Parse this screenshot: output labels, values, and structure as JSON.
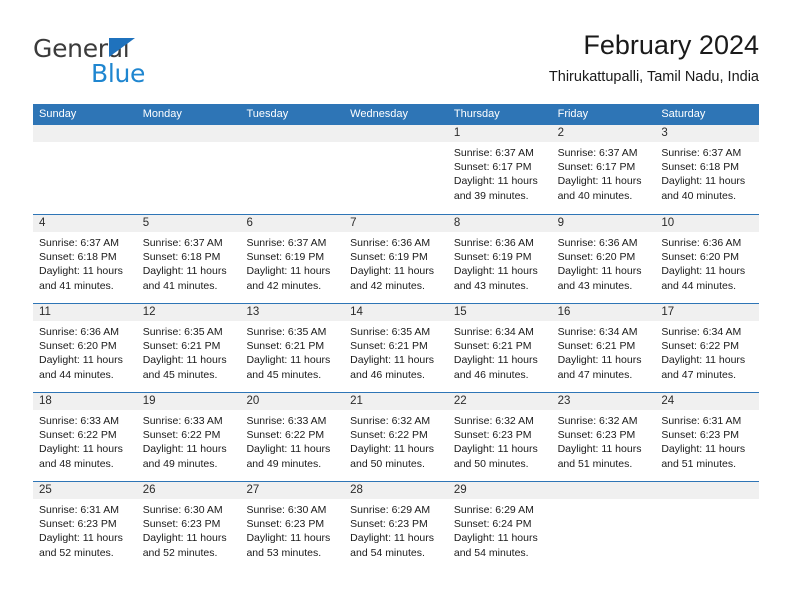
{
  "brand": {
    "name_top": "General",
    "name_bottom": "Blue",
    "triangle_icon": "triangle-icon",
    "accent_color": "#1f86d0",
    "header_color": "#2e75b6"
  },
  "header": {
    "title": "February 2024",
    "subtitle": "Thirukattupalli, Tamil Nadu, India"
  },
  "calendar": {
    "weekdays": [
      "Sunday",
      "Monday",
      "Tuesday",
      "Wednesday",
      "Thursday",
      "Friday",
      "Saturday"
    ],
    "weeks": [
      [
        {
          "day": "",
          "lines": []
        },
        {
          "day": "",
          "lines": []
        },
        {
          "day": "",
          "lines": []
        },
        {
          "day": "",
          "lines": []
        },
        {
          "day": "1",
          "lines": [
            "Sunrise: 6:37 AM",
            "Sunset: 6:17 PM",
            "Daylight: 11 hours",
            "and 39 minutes."
          ]
        },
        {
          "day": "2",
          "lines": [
            "Sunrise: 6:37 AM",
            "Sunset: 6:17 PM",
            "Daylight: 11 hours",
            "and 40 minutes."
          ]
        },
        {
          "day": "3",
          "lines": [
            "Sunrise: 6:37 AM",
            "Sunset: 6:18 PM",
            "Daylight: 11 hours",
            "and 40 minutes."
          ]
        }
      ],
      [
        {
          "day": "4",
          "lines": [
            "Sunrise: 6:37 AM",
            "Sunset: 6:18 PM",
            "Daylight: 11 hours",
            "and 41 minutes."
          ]
        },
        {
          "day": "5",
          "lines": [
            "Sunrise: 6:37 AM",
            "Sunset: 6:18 PM",
            "Daylight: 11 hours",
            "and 41 minutes."
          ]
        },
        {
          "day": "6",
          "lines": [
            "Sunrise: 6:37 AM",
            "Sunset: 6:19 PM",
            "Daylight: 11 hours",
            "and 42 minutes."
          ]
        },
        {
          "day": "7",
          "lines": [
            "Sunrise: 6:36 AM",
            "Sunset: 6:19 PM",
            "Daylight: 11 hours",
            "and 42 minutes."
          ]
        },
        {
          "day": "8",
          "lines": [
            "Sunrise: 6:36 AM",
            "Sunset: 6:19 PM",
            "Daylight: 11 hours",
            "and 43 minutes."
          ]
        },
        {
          "day": "9",
          "lines": [
            "Sunrise: 6:36 AM",
            "Sunset: 6:20 PM",
            "Daylight: 11 hours",
            "and 43 minutes."
          ]
        },
        {
          "day": "10",
          "lines": [
            "Sunrise: 6:36 AM",
            "Sunset: 6:20 PM",
            "Daylight: 11 hours",
            "and 44 minutes."
          ]
        }
      ],
      [
        {
          "day": "11",
          "lines": [
            "Sunrise: 6:36 AM",
            "Sunset: 6:20 PM",
            "Daylight: 11 hours",
            "and 44 minutes."
          ]
        },
        {
          "day": "12",
          "lines": [
            "Sunrise: 6:35 AM",
            "Sunset: 6:21 PM",
            "Daylight: 11 hours",
            "and 45 minutes."
          ]
        },
        {
          "day": "13",
          "lines": [
            "Sunrise: 6:35 AM",
            "Sunset: 6:21 PM",
            "Daylight: 11 hours",
            "and 45 minutes."
          ]
        },
        {
          "day": "14",
          "lines": [
            "Sunrise: 6:35 AM",
            "Sunset: 6:21 PM",
            "Daylight: 11 hours",
            "and 46 minutes."
          ]
        },
        {
          "day": "15",
          "lines": [
            "Sunrise: 6:34 AM",
            "Sunset: 6:21 PM",
            "Daylight: 11 hours",
            "and 46 minutes."
          ]
        },
        {
          "day": "16",
          "lines": [
            "Sunrise: 6:34 AM",
            "Sunset: 6:21 PM",
            "Daylight: 11 hours",
            "and 47 minutes."
          ]
        },
        {
          "day": "17",
          "lines": [
            "Sunrise: 6:34 AM",
            "Sunset: 6:22 PM",
            "Daylight: 11 hours",
            "and 47 minutes."
          ]
        }
      ],
      [
        {
          "day": "18",
          "lines": [
            "Sunrise: 6:33 AM",
            "Sunset: 6:22 PM",
            "Daylight: 11 hours",
            "and 48 minutes."
          ]
        },
        {
          "day": "19",
          "lines": [
            "Sunrise: 6:33 AM",
            "Sunset: 6:22 PM",
            "Daylight: 11 hours",
            "and 49 minutes."
          ]
        },
        {
          "day": "20",
          "lines": [
            "Sunrise: 6:33 AM",
            "Sunset: 6:22 PM",
            "Daylight: 11 hours",
            "and 49 minutes."
          ]
        },
        {
          "day": "21",
          "lines": [
            "Sunrise: 6:32 AM",
            "Sunset: 6:22 PM",
            "Daylight: 11 hours",
            "and 50 minutes."
          ]
        },
        {
          "day": "22",
          "lines": [
            "Sunrise: 6:32 AM",
            "Sunset: 6:23 PM",
            "Daylight: 11 hours",
            "and 50 minutes."
          ]
        },
        {
          "day": "23",
          "lines": [
            "Sunrise: 6:32 AM",
            "Sunset: 6:23 PM",
            "Daylight: 11 hours",
            "and 51 minutes."
          ]
        },
        {
          "day": "24",
          "lines": [
            "Sunrise: 6:31 AM",
            "Sunset: 6:23 PM",
            "Daylight: 11 hours",
            "and 51 minutes."
          ]
        }
      ],
      [
        {
          "day": "25",
          "lines": [
            "Sunrise: 6:31 AM",
            "Sunset: 6:23 PM",
            "Daylight: 11 hours",
            "and 52 minutes."
          ]
        },
        {
          "day": "26",
          "lines": [
            "Sunrise: 6:30 AM",
            "Sunset: 6:23 PM",
            "Daylight: 11 hours",
            "and 52 minutes."
          ]
        },
        {
          "day": "27",
          "lines": [
            "Sunrise: 6:30 AM",
            "Sunset: 6:23 PM",
            "Daylight: 11 hours",
            "and 53 minutes."
          ]
        },
        {
          "day": "28",
          "lines": [
            "Sunrise: 6:29 AM",
            "Sunset: 6:23 PM",
            "Daylight: 11 hours",
            "and 54 minutes."
          ]
        },
        {
          "day": "29",
          "lines": [
            "Sunrise: 6:29 AM",
            "Sunset: 6:24 PM",
            "Daylight: 11 hours",
            "and 54 minutes."
          ]
        },
        {
          "day": "",
          "lines": []
        },
        {
          "day": "",
          "lines": []
        }
      ]
    ]
  }
}
